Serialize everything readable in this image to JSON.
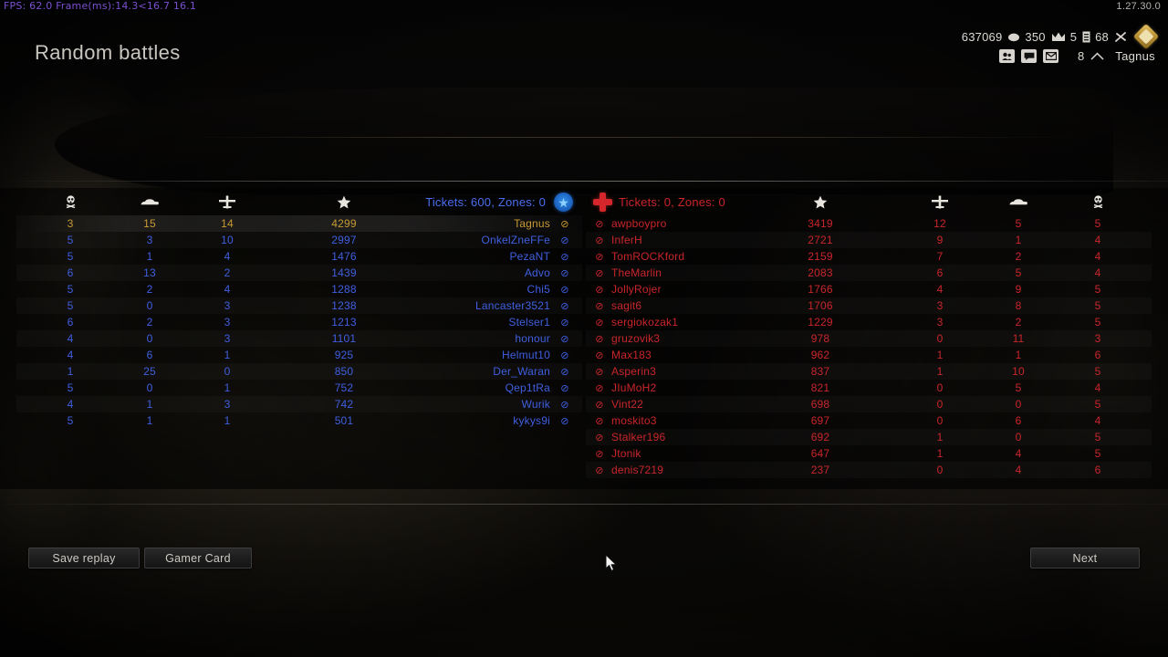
{
  "overlay": {
    "fps_text": "FPS: 62.0 Frame(ms):14.3<16.7 16.1",
    "version": "1.27.30.0"
  },
  "header": {
    "title": "Random battles"
  },
  "hud": {
    "silver": "637069",
    "gold": "350",
    "containers": "5",
    "tools": "68",
    "rank": "8",
    "player_name": "Tagnus",
    "icons": {
      "silver": "silver-icon",
      "gold": "gold-crown-icon",
      "container": "container-icon",
      "tools": "crossed-tools-icon",
      "clan": "clan-badge-icon",
      "friends": "friends-icon",
      "chat": "chat-icon",
      "mail": "mail-icon",
      "rank_chevron": "rank-chevron-icon"
    }
  },
  "scoreboard": {
    "allies": {
      "tickets_label": "Tickets: 600, Zones: 0",
      "emblem": "blue-star-emblem",
      "columns": [
        {
          "key": "deaths",
          "icon": "skull-icon"
        },
        {
          "key": "tanks",
          "icon": "tank-icon"
        },
        {
          "key": "planes",
          "icon": "plane-icon"
        },
        {
          "key": "score",
          "icon": "star-icon"
        },
        {
          "key": "player",
          "icon": "player-name"
        }
      ],
      "rows": [
        {
          "deaths": "3",
          "tanks": "15",
          "planes": "14",
          "score": "4299",
          "name": "Tagnus",
          "self": true
        },
        {
          "deaths": "5",
          "tanks": "3",
          "planes": "10",
          "score": "2997",
          "name": "OnkelZneFFe",
          "self": false
        },
        {
          "deaths": "5",
          "tanks": "1",
          "planes": "4",
          "score": "1476",
          "name": "PezaNT",
          "self": false
        },
        {
          "deaths": "6",
          "tanks": "13",
          "planes": "2",
          "score": "1439",
          "name": "Advo",
          "self": false
        },
        {
          "deaths": "5",
          "tanks": "2",
          "planes": "4",
          "score": "1288",
          "name": "Chi5",
          "self": false
        },
        {
          "deaths": "5",
          "tanks": "0",
          "planes": "3",
          "score": "1238",
          "name": "Lancaster3521",
          "self": false
        },
        {
          "deaths": "6",
          "tanks": "2",
          "planes": "3",
          "score": "1213",
          "name": "Stelser1",
          "self": false
        },
        {
          "deaths": "4",
          "tanks": "0",
          "planes": "3",
          "score": "1101",
          "name": "honour",
          "self": false
        },
        {
          "deaths": "4",
          "tanks": "6",
          "planes": "1",
          "score": "925",
          "name": "Helmut10",
          "self": false
        },
        {
          "deaths": "1",
          "tanks": "25",
          "planes": "0",
          "score": "850",
          "name": "Der_Waran",
          "self": false
        },
        {
          "deaths": "5",
          "tanks": "0",
          "planes": "1",
          "score": "752",
          "name": "Qep1tRa",
          "self": false
        },
        {
          "deaths": "4",
          "tanks": "1",
          "planes": "3",
          "score": "742",
          "name": "Wurik",
          "self": false
        },
        {
          "deaths": "5",
          "tanks": "1",
          "planes": "1",
          "score": "501",
          "name": "kykys9i",
          "self": false
        }
      ]
    },
    "enemies": {
      "tickets_label": "Tickets: 0, Zones: 0",
      "emblem": "red-cross-emblem",
      "columns": [
        {
          "key": "player",
          "icon": "player-name"
        },
        {
          "key": "score",
          "icon": "star-icon"
        },
        {
          "key": "planes",
          "icon": "plane-icon"
        },
        {
          "key": "tanks",
          "icon": "tank-icon"
        },
        {
          "key": "deaths",
          "icon": "skull-icon"
        }
      ],
      "rows": [
        {
          "name": "awpboypro",
          "score": "3419",
          "planes": "12",
          "tanks": "5",
          "deaths": "5"
        },
        {
          "name": "InferH",
          "score": "2721",
          "planes": "9",
          "tanks": "1",
          "deaths": "4"
        },
        {
          "name": "TomROCKford",
          "score": "2159",
          "planes": "7",
          "tanks": "2",
          "deaths": "4"
        },
        {
          "name": "TheMarlin",
          "score": "2083",
          "planes": "6",
          "tanks": "5",
          "deaths": "4"
        },
        {
          "name": "JollyRojer",
          "score": "1766",
          "planes": "4",
          "tanks": "9",
          "deaths": "5"
        },
        {
          "name": "sagit6",
          "score": "1706",
          "planes": "3",
          "tanks": "8",
          "deaths": "5"
        },
        {
          "name": "sergiokozak1",
          "score": "1229",
          "planes": "3",
          "tanks": "2",
          "deaths": "5"
        },
        {
          "name": "gruzovik3",
          "score": "978",
          "planes": "0",
          "tanks": "11",
          "deaths": "3"
        },
        {
          "name": "Max183",
          "score": "962",
          "planes": "1",
          "tanks": "1",
          "deaths": "6"
        },
        {
          "name": "Asperin3",
          "score": "837",
          "planes": "1",
          "tanks": "10",
          "deaths": "5"
        },
        {
          "name": "JIuMoH2",
          "score": "821",
          "planes": "0",
          "tanks": "5",
          "deaths": "4"
        },
        {
          "name": "Vint22",
          "score": "698",
          "planes": "0",
          "tanks": "0",
          "deaths": "5"
        },
        {
          "name": "moskito3",
          "score": "697",
          "planes": "0",
          "tanks": "6",
          "deaths": "4"
        },
        {
          "name": "Stalker196",
          "score": "692",
          "planes": "1",
          "tanks": "0",
          "deaths": "5"
        },
        {
          "name": "Jtonik",
          "score": "647",
          "planes": "1",
          "tanks": "4",
          "deaths": "5"
        },
        {
          "name": "denis7219",
          "score": "237",
          "planes": "0",
          "tanks": "4",
          "deaths": "6"
        }
      ]
    }
  },
  "footer": {
    "save_replay_label": "Save replay",
    "gamer_card_label": "Gamer Card",
    "next_label": "Next"
  },
  "colors": {
    "ally": "#3f5fe0",
    "enemy": "#c9252a",
    "self": "#c79a33",
    "fps": "#7a4fd0"
  }
}
